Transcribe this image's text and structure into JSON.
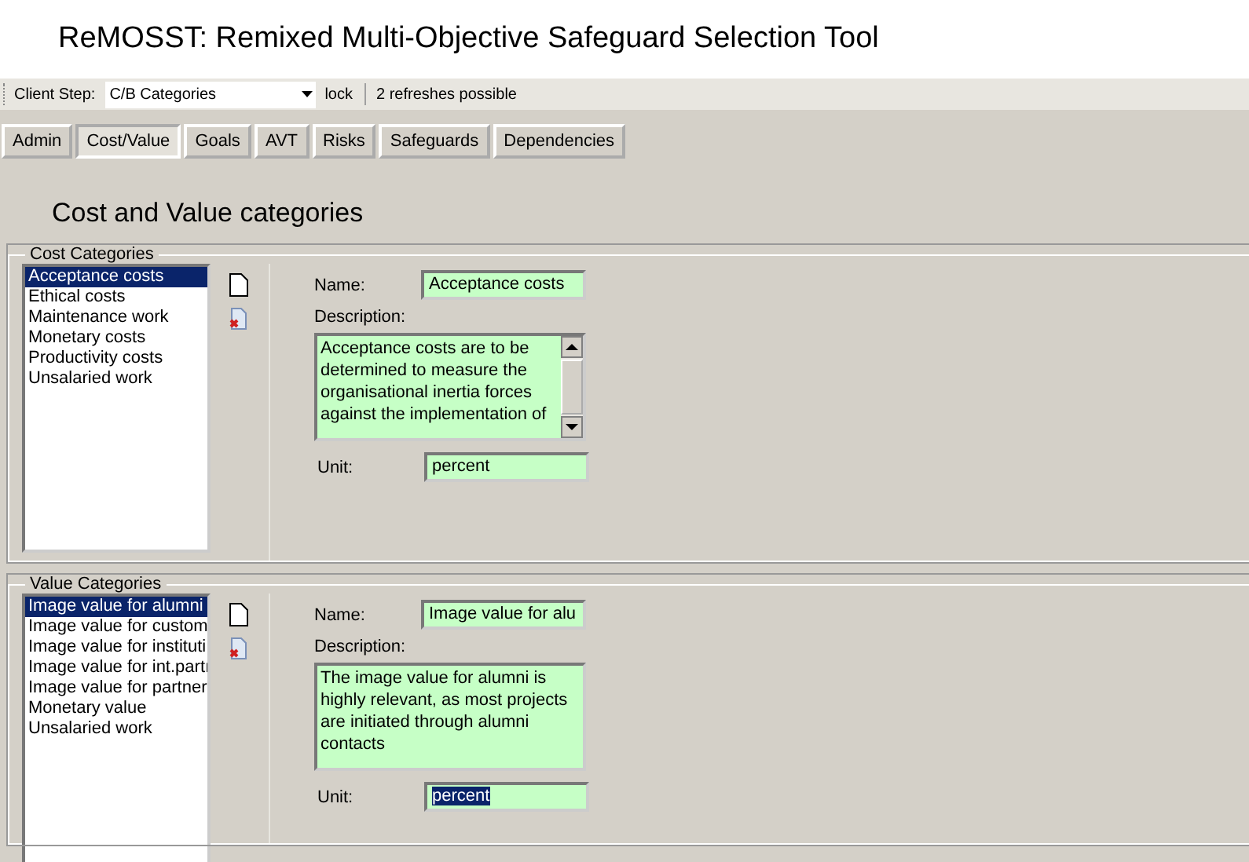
{
  "window": {
    "title": "ReMOSST: Remixed Multi-Objective Safeguard Selection Tool"
  },
  "toolbar": {
    "client_step_label": "Client Step:",
    "client_step_value": "C/B Categories",
    "lock": "lock",
    "refreshes": "2 refreshes possible"
  },
  "tabs": [
    {
      "label": "Admin",
      "selected": false
    },
    {
      "label": "Cost/Value",
      "selected": true
    },
    {
      "label": "Goals",
      "selected": false
    },
    {
      "label": "AVT",
      "selected": false
    },
    {
      "label": "Risks",
      "selected": false
    },
    {
      "label": "Safeguards",
      "selected": false
    },
    {
      "label": "Dependencies",
      "selected": false
    }
  ],
  "heading": "Cost and Value categories",
  "groups": [
    {
      "title": "Cost Categories",
      "items": [
        {
          "label": "Acceptance costs",
          "selected": true
        },
        {
          "label": "Ethical costs",
          "selected": false
        },
        {
          "label": "Maintenance work",
          "selected": false
        },
        {
          "label": "Monetary costs",
          "selected": false
        },
        {
          "label": "Productivity costs",
          "selected": false
        },
        {
          "label": "Unsalaried work",
          "selected": false
        }
      ],
      "name_label": "Name:",
      "name_value": "Acceptance costs",
      "description_label": "Description:",
      "description": "Acceptance costs are to be\ndetermined to measure the\norganisational inertia forces\nagainst the implementation of",
      "description_scrollbar": true,
      "unit_label": "Unit:",
      "unit_value": "percent",
      "unit_text_selected": false
    },
    {
      "title": "Value Categories",
      "items": [
        {
          "label": "Image value for alumni",
          "selected": true
        },
        {
          "label": "Image value for custom",
          "selected": false
        },
        {
          "label": "Image value for instituti",
          "selected": false
        },
        {
          "label": "Image value for int.partı",
          "selected": false
        },
        {
          "label": "Image value for partner",
          "selected": false
        },
        {
          "label": "Monetary value",
          "selected": false
        },
        {
          "label": "Unsalaried work",
          "selected": false
        }
      ],
      "name_label": "Name:",
      "name_value": "Image value for alu",
      "description_label": "Description:",
      "description": "The image value for alumni is\nhighly relevant, as most projects\nare initiated through alumni\ncontacts",
      "description_scrollbar": false,
      "unit_label": "Unit:",
      "unit_value": "percent",
      "unit_text_selected": true
    }
  ]
}
